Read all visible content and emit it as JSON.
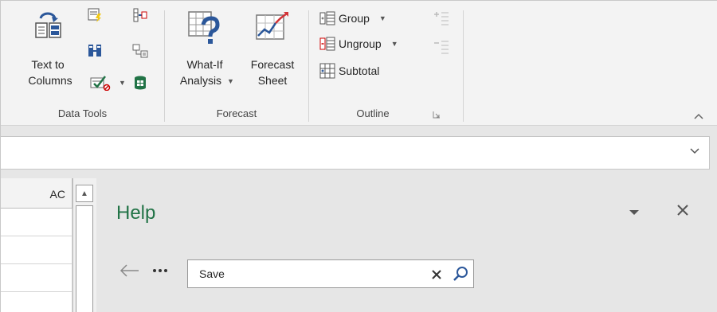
{
  "ribbon": {
    "data_tools": {
      "label": "Data Tools",
      "text_to_columns_line1": "Text to",
      "text_to_columns_line2": "Columns"
    },
    "forecast": {
      "label": "Forecast",
      "whatif_line1": "What-If",
      "whatif_line2": "Analysis",
      "forecast_sheet_line1": "Forecast",
      "forecast_sheet_line2": "Sheet"
    },
    "outline": {
      "label": "Outline",
      "group": "Group",
      "ungroup": "Ungroup",
      "subtotal": "Subtotal"
    }
  },
  "sheet": {
    "column_header": "AC"
  },
  "help_pane": {
    "title": "Help",
    "search_value": "Save"
  },
  "colors": {
    "accent_green": "#217346",
    "icon_blue": "#2b579a",
    "ribbon_bg": "#f3f3f3"
  },
  "icons": [
    "text-to-columns-icon",
    "flash-fill-icon",
    "remove-duplicates-icon",
    "data-validation-icon",
    "consolidate-icon",
    "relationships-icon",
    "manage-data-model-icon",
    "what-if-icon",
    "forecast-sheet-icon",
    "group-icon",
    "ungroup-icon",
    "subtotal-icon",
    "show-detail-icon",
    "hide-detail-icon",
    "back-arrow-icon",
    "more-icon",
    "search-icon",
    "close-icon"
  ]
}
